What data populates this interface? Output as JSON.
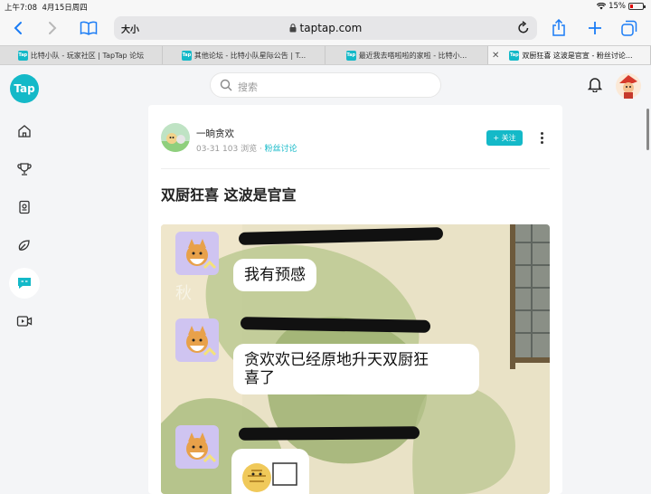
{
  "status": {
    "time": "上午7:08",
    "date": "4月15日周四",
    "battery": "15%"
  },
  "toolbar": {
    "text_size": "大小",
    "url": "taptap.com"
  },
  "tabs": [
    {
      "label": "比特小队 - 玩家社区 | TapTap 论坛"
    },
    {
      "label": "其他论坛 - 比特小队星际公告 | T..."
    },
    {
      "label": "最近我去嗒啦啦的家啦 - 比特小..."
    },
    {
      "label": "双厨狂喜 这波是官宣 - 粉丝讨论..."
    }
  ],
  "brand": {
    "logo_text": "Tap",
    "accent": "#14b9c8"
  },
  "search": {
    "placeholder": "搜索"
  },
  "post": {
    "author": "一晌贪欢",
    "date": "03-31",
    "views": "103 浏览",
    "forum": "粉丝讨论",
    "follow_label": "+ 关注",
    "title": "双厨狂喜 这波是官宣"
  },
  "image": {
    "bubble1": "我有预感",
    "bubble2_line1": "贪欢欢已经原地升天双厨狂",
    "bubble2_line2": "喜了",
    "corner_char": "秋"
  },
  "icons": [
    "back-icon",
    "forward-icon",
    "bookmarks-icon",
    "reload-icon",
    "share-icon",
    "new-tab-icon",
    "tabs-icon",
    "home-icon",
    "trophy-icon",
    "game-library-icon",
    "explore-icon",
    "forum-icon",
    "video-icon",
    "bell-icon",
    "search-icon"
  ]
}
